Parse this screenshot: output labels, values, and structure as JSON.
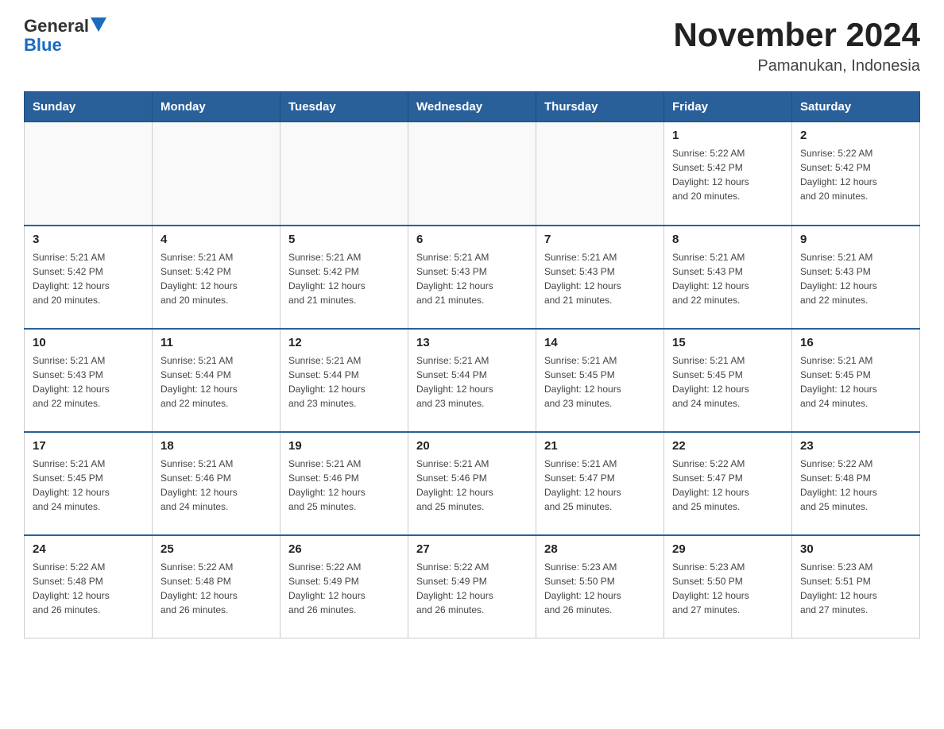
{
  "header": {
    "logo_text_black": "General",
    "logo_text_blue": "Blue",
    "month_title": "November 2024",
    "location": "Pamanukan, Indonesia"
  },
  "days_of_week": [
    "Sunday",
    "Monday",
    "Tuesday",
    "Wednesday",
    "Thursday",
    "Friday",
    "Saturday"
  ],
  "weeks": [
    [
      {
        "day": "",
        "info": ""
      },
      {
        "day": "",
        "info": ""
      },
      {
        "day": "",
        "info": ""
      },
      {
        "day": "",
        "info": ""
      },
      {
        "day": "",
        "info": ""
      },
      {
        "day": "1",
        "info": "Sunrise: 5:22 AM\nSunset: 5:42 PM\nDaylight: 12 hours\nand 20 minutes."
      },
      {
        "day": "2",
        "info": "Sunrise: 5:22 AM\nSunset: 5:42 PM\nDaylight: 12 hours\nand 20 minutes."
      }
    ],
    [
      {
        "day": "3",
        "info": "Sunrise: 5:21 AM\nSunset: 5:42 PM\nDaylight: 12 hours\nand 20 minutes."
      },
      {
        "day": "4",
        "info": "Sunrise: 5:21 AM\nSunset: 5:42 PM\nDaylight: 12 hours\nand 20 minutes."
      },
      {
        "day": "5",
        "info": "Sunrise: 5:21 AM\nSunset: 5:42 PM\nDaylight: 12 hours\nand 21 minutes."
      },
      {
        "day": "6",
        "info": "Sunrise: 5:21 AM\nSunset: 5:43 PM\nDaylight: 12 hours\nand 21 minutes."
      },
      {
        "day": "7",
        "info": "Sunrise: 5:21 AM\nSunset: 5:43 PM\nDaylight: 12 hours\nand 21 minutes."
      },
      {
        "day": "8",
        "info": "Sunrise: 5:21 AM\nSunset: 5:43 PM\nDaylight: 12 hours\nand 22 minutes."
      },
      {
        "day": "9",
        "info": "Sunrise: 5:21 AM\nSunset: 5:43 PM\nDaylight: 12 hours\nand 22 minutes."
      }
    ],
    [
      {
        "day": "10",
        "info": "Sunrise: 5:21 AM\nSunset: 5:43 PM\nDaylight: 12 hours\nand 22 minutes."
      },
      {
        "day": "11",
        "info": "Sunrise: 5:21 AM\nSunset: 5:44 PM\nDaylight: 12 hours\nand 22 minutes."
      },
      {
        "day": "12",
        "info": "Sunrise: 5:21 AM\nSunset: 5:44 PM\nDaylight: 12 hours\nand 23 minutes."
      },
      {
        "day": "13",
        "info": "Sunrise: 5:21 AM\nSunset: 5:44 PM\nDaylight: 12 hours\nand 23 minutes."
      },
      {
        "day": "14",
        "info": "Sunrise: 5:21 AM\nSunset: 5:45 PM\nDaylight: 12 hours\nand 23 minutes."
      },
      {
        "day": "15",
        "info": "Sunrise: 5:21 AM\nSunset: 5:45 PM\nDaylight: 12 hours\nand 24 minutes."
      },
      {
        "day": "16",
        "info": "Sunrise: 5:21 AM\nSunset: 5:45 PM\nDaylight: 12 hours\nand 24 minutes."
      }
    ],
    [
      {
        "day": "17",
        "info": "Sunrise: 5:21 AM\nSunset: 5:45 PM\nDaylight: 12 hours\nand 24 minutes."
      },
      {
        "day": "18",
        "info": "Sunrise: 5:21 AM\nSunset: 5:46 PM\nDaylight: 12 hours\nand 24 minutes."
      },
      {
        "day": "19",
        "info": "Sunrise: 5:21 AM\nSunset: 5:46 PM\nDaylight: 12 hours\nand 25 minutes."
      },
      {
        "day": "20",
        "info": "Sunrise: 5:21 AM\nSunset: 5:46 PM\nDaylight: 12 hours\nand 25 minutes."
      },
      {
        "day": "21",
        "info": "Sunrise: 5:21 AM\nSunset: 5:47 PM\nDaylight: 12 hours\nand 25 minutes."
      },
      {
        "day": "22",
        "info": "Sunrise: 5:22 AM\nSunset: 5:47 PM\nDaylight: 12 hours\nand 25 minutes."
      },
      {
        "day": "23",
        "info": "Sunrise: 5:22 AM\nSunset: 5:48 PM\nDaylight: 12 hours\nand 25 minutes."
      }
    ],
    [
      {
        "day": "24",
        "info": "Sunrise: 5:22 AM\nSunset: 5:48 PM\nDaylight: 12 hours\nand 26 minutes."
      },
      {
        "day": "25",
        "info": "Sunrise: 5:22 AM\nSunset: 5:48 PM\nDaylight: 12 hours\nand 26 minutes."
      },
      {
        "day": "26",
        "info": "Sunrise: 5:22 AM\nSunset: 5:49 PM\nDaylight: 12 hours\nand 26 minutes."
      },
      {
        "day": "27",
        "info": "Sunrise: 5:22 AM\nSunset: 5:49 PM\nDaylight: 12 hours\nand 26 minutes."
      },
      {
        "day": "28",
        "info": "Sunrise: 5:23 AM\nSunset: 5:50 PM\nDaylight: 12 hours\nand 26 minutes."
      },
      {
        "day": "29",
        "info": "Sunrise: 5:23 AM\nSunset: 5:50 PM\nDaylight: 12 hours\nand 27 minutes."
      },
      {
        "day": "30",
        "info": "Sunrise: 5:23 AM\nSunset: 5:51 PM\nDaylight: 12 hours\nand 27 minutes."
      }
    ]
  ]
}
